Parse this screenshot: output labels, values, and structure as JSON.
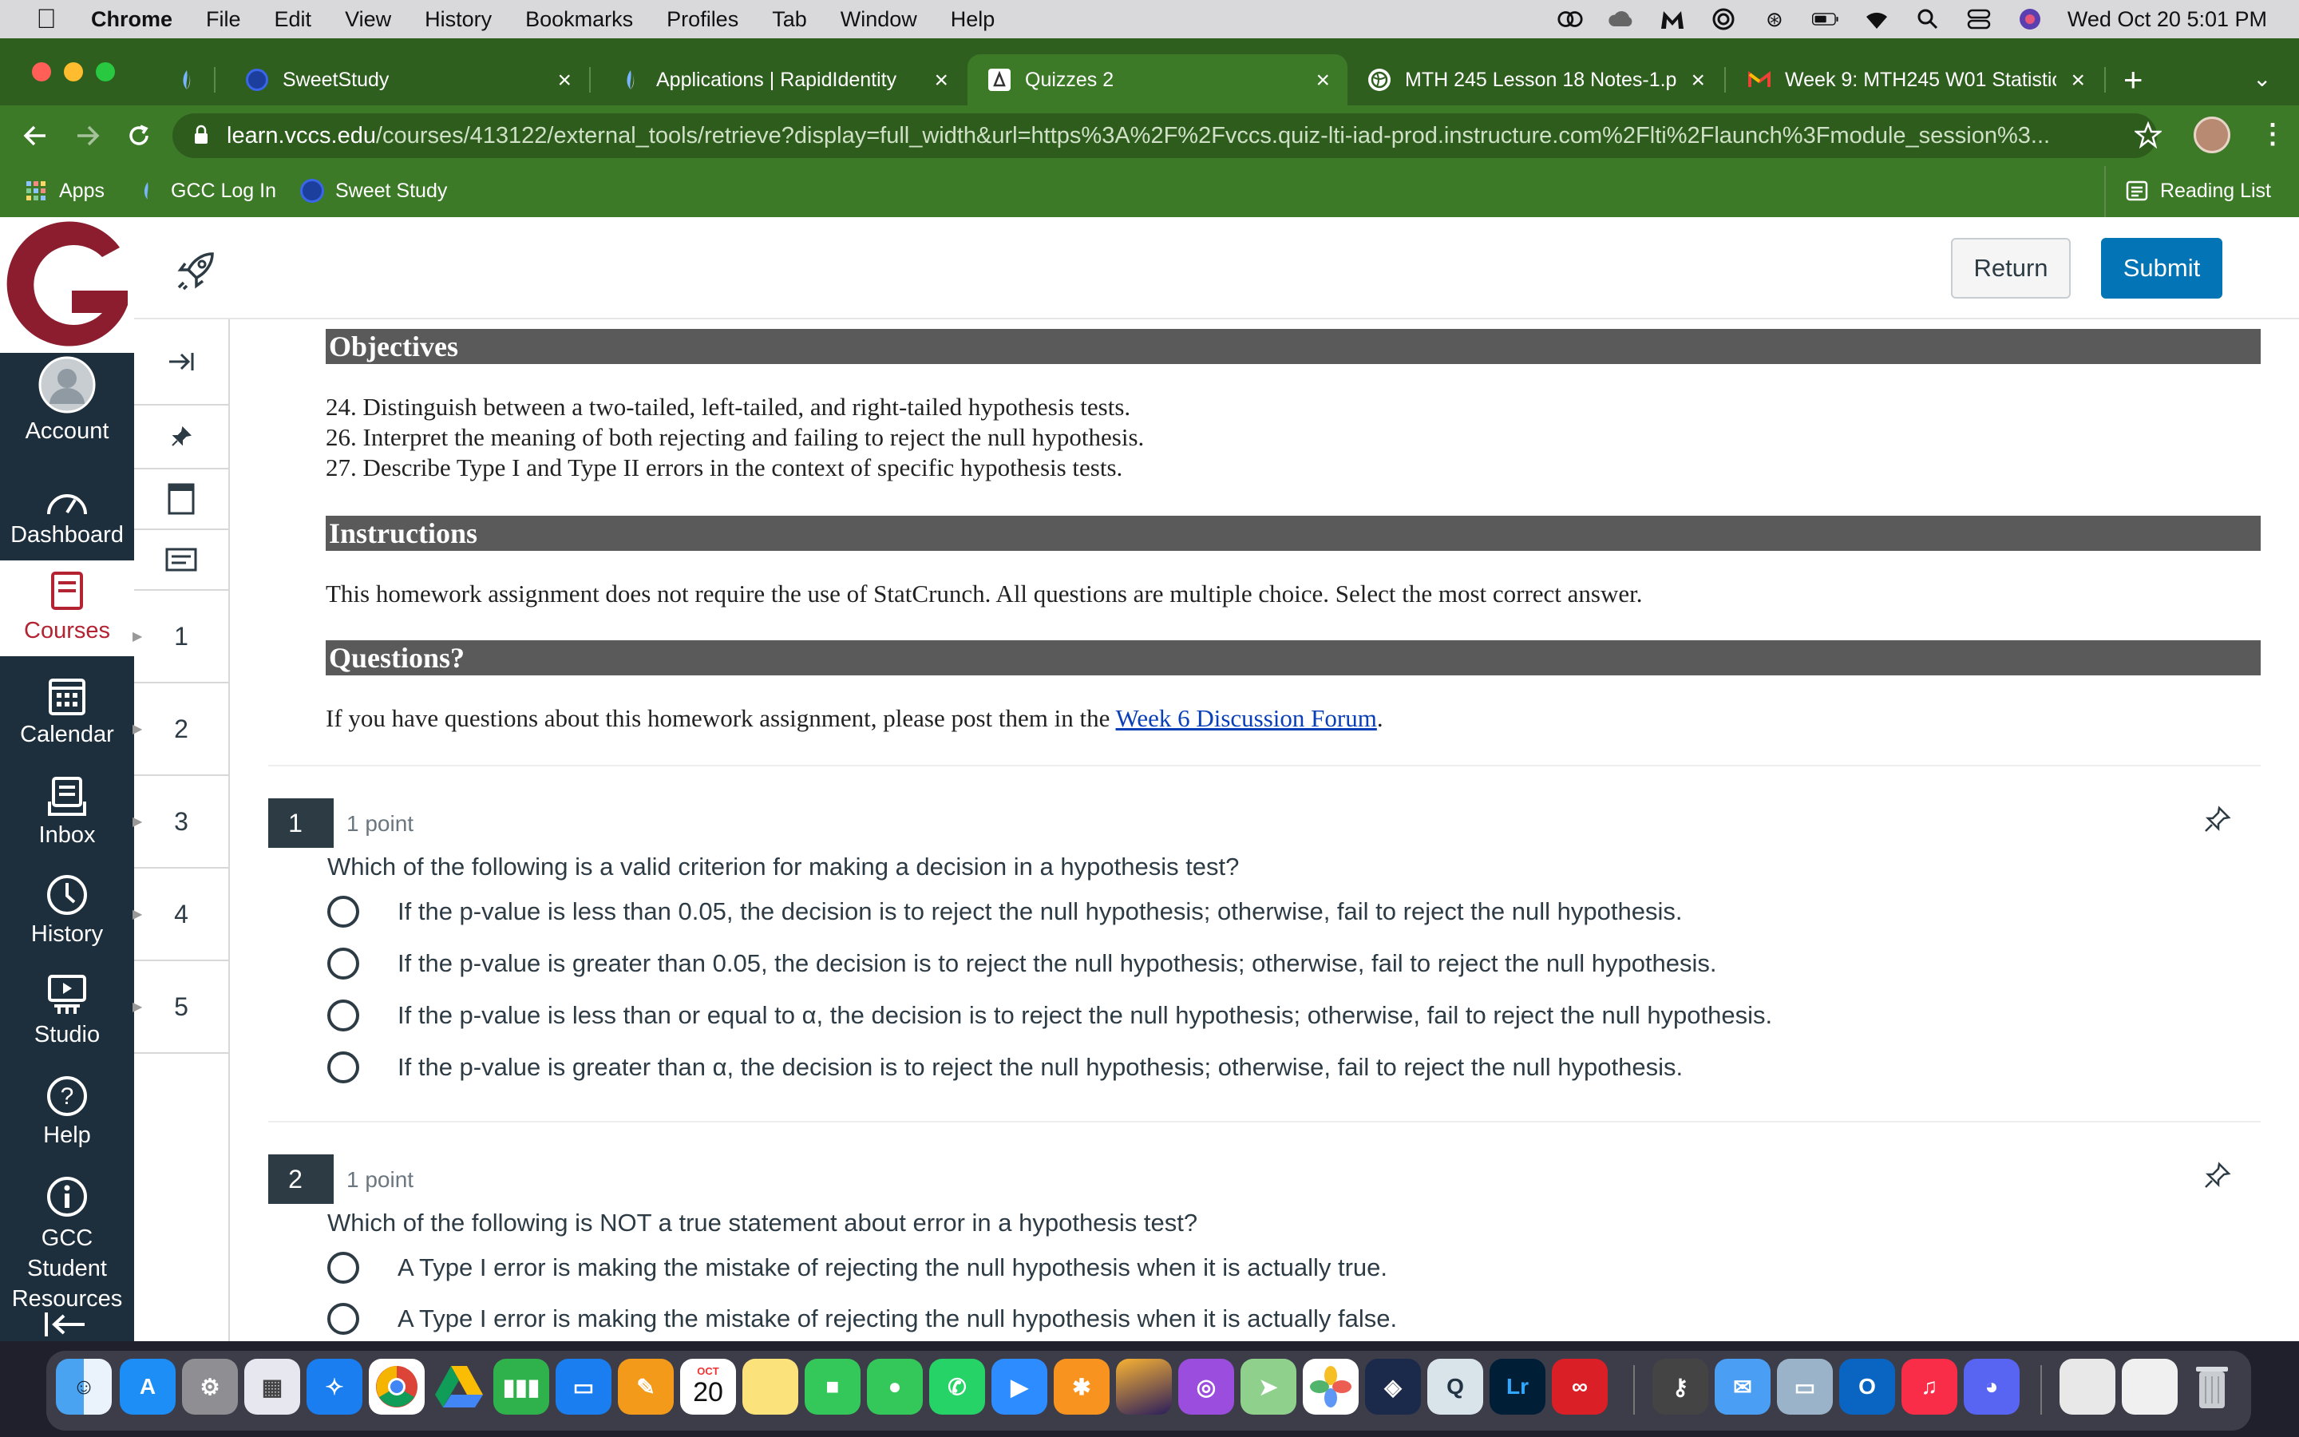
{
  "menubar": {
    "app": "Chrome",
    "items": [
      "File",
      "Edit",
      "View",
      "History",
      "Bookmarks",
      "Profiles",
      "Tab",
      "Window",
      "Help"
    ],
    "clock": "Wed Oct 20  5:01 PM"
  },
  "tabs": [
    {
      "title": "",
      "icon": "canvas-flame-icon"
    },
    {
      "title": "SweetStudy",
      "icon": "sweetstudy-icon"
    },
    {
      "title": "Applications | RapidIdentity",
      "icon": "canvas-flame-icon"
    },
    {
      "title": "Quizzes 2",
      "icon": "quiz-icon"
    },
    {
      "title": "MTH 245 Lesson 18 Notes-1.p",
      "icon": "globe-icon"
    },
    {
      "title": "Week 9: MTH245 W01 Statistic",
      "icon": "gmail-icon"
    }
  ],
  "address": {
    "host": "learn.vccs.edu",
    "path": "/courses/413122/external_tools/retrieve?display=full_width&url=https%3A%2F%2Fvccs.quiz-lti-iad-prod.instructure.com%2Flti%2Flaunch%3Fmodule_session%3..."
  },
  "bookmarks": {
    "apps": "Apps",
    "items": [
      "GCC Log In",
      "Sweet Study"
    ],
    "reading_list": "Reading List"
  },
  "global_nav": [
    {
      "label": "Account",
      "icon": "account-avatar-icon"
    },
    {
      "label": "Dashboard",
      "icon": "dashboard-gauge-icon"
    },
    {
      "label": "Courses",
      "icon": "courses-book-icon"
    },
    {
      "label": "Calendar",
      "icon": "calendar-icon"
    },
    {
      "label": "Inbox",
      "icon": "inbox-icon"
    },
    {
      "label": "History",
      "icon": "history-clock-icon"
    },
    {
      "label": "Studio",
      "icon": "studio-icon"
    },
    {
      "label": "Help",
      "icon": "help-icon"
    },
    {
      "label": "GCC Student Resources",
      "icon": "info-icon"
    }
  ],
  "toolbar": {
    "return_label": "Return",
    "submit_label": "Submit"
  },
  "side_nav": [
    "1",
    "2",
    "3",
    "4",
    "5"
  ],
  "content": {
    "objectives_heading": "Objectives",
    "objectives": [
      "24. Distinguish between a two-tailed, left-tailed, and right-tailed hypothesis tests.",
      "26. Interpret the meaning of both rejecting and failing to reject the null hypothesis.",
      "27. Describe Type I and Type II errors in the context of specific hypothesis tests."
    ],
    "instructions_heading": "Instructions",
    "instructions": "This homework assignment does not require the use of StatCrunch. All questions are multiple choice. Select the most correct answer.",
    "questions_heading": "Questions?",
    "questions_text": "If you have questions about this homework assignment, please post them in the ",
    "questions_link": "Week 6 Discussion Forum",
    "questions_end": "."
  },
  "questions": [
    {
      "number": "1",
      "points": "1 point",
      "text": "Which of the following is a valid criterion for making a decision in a hypothesis test?",
      "options": [
        "If the p-value is less than 0.05, the decision is to reject the null hypothesis; otherwise, fail to reject the null hypothesis.",
        "If the p-value is greater than 0.05, the decision is to reject the null hypothesis; otherwise, fail to reject the null hypothesis.",
        "If the p-value is less than or equal to α, the decision is to reject the null hypothesis; otherwise, fail to reject the null hypothesis.",
        "If the p-value is greater than α, the decision is to reject the null hypothesis; otherwise, fail to reject the null hypothesis."
      ]
    },
    {
      "number": "2",
      "points": "1 point",
      "text": "Which of the following is NOT a true statement about error in a hypothesis test?",
      "options": [
        "A Type I error is making the mistake of rejecting the null hypothesis when it is actually true.",
        "A Type I error is making the mistake of rejecting the null hypothesis when it is actually false."
      ]
    }
  ],
  "dock": {
    "calendar_month": "OCT",
    "calendar_day": "20",
    "lightroom": "Lr"
  }
}
